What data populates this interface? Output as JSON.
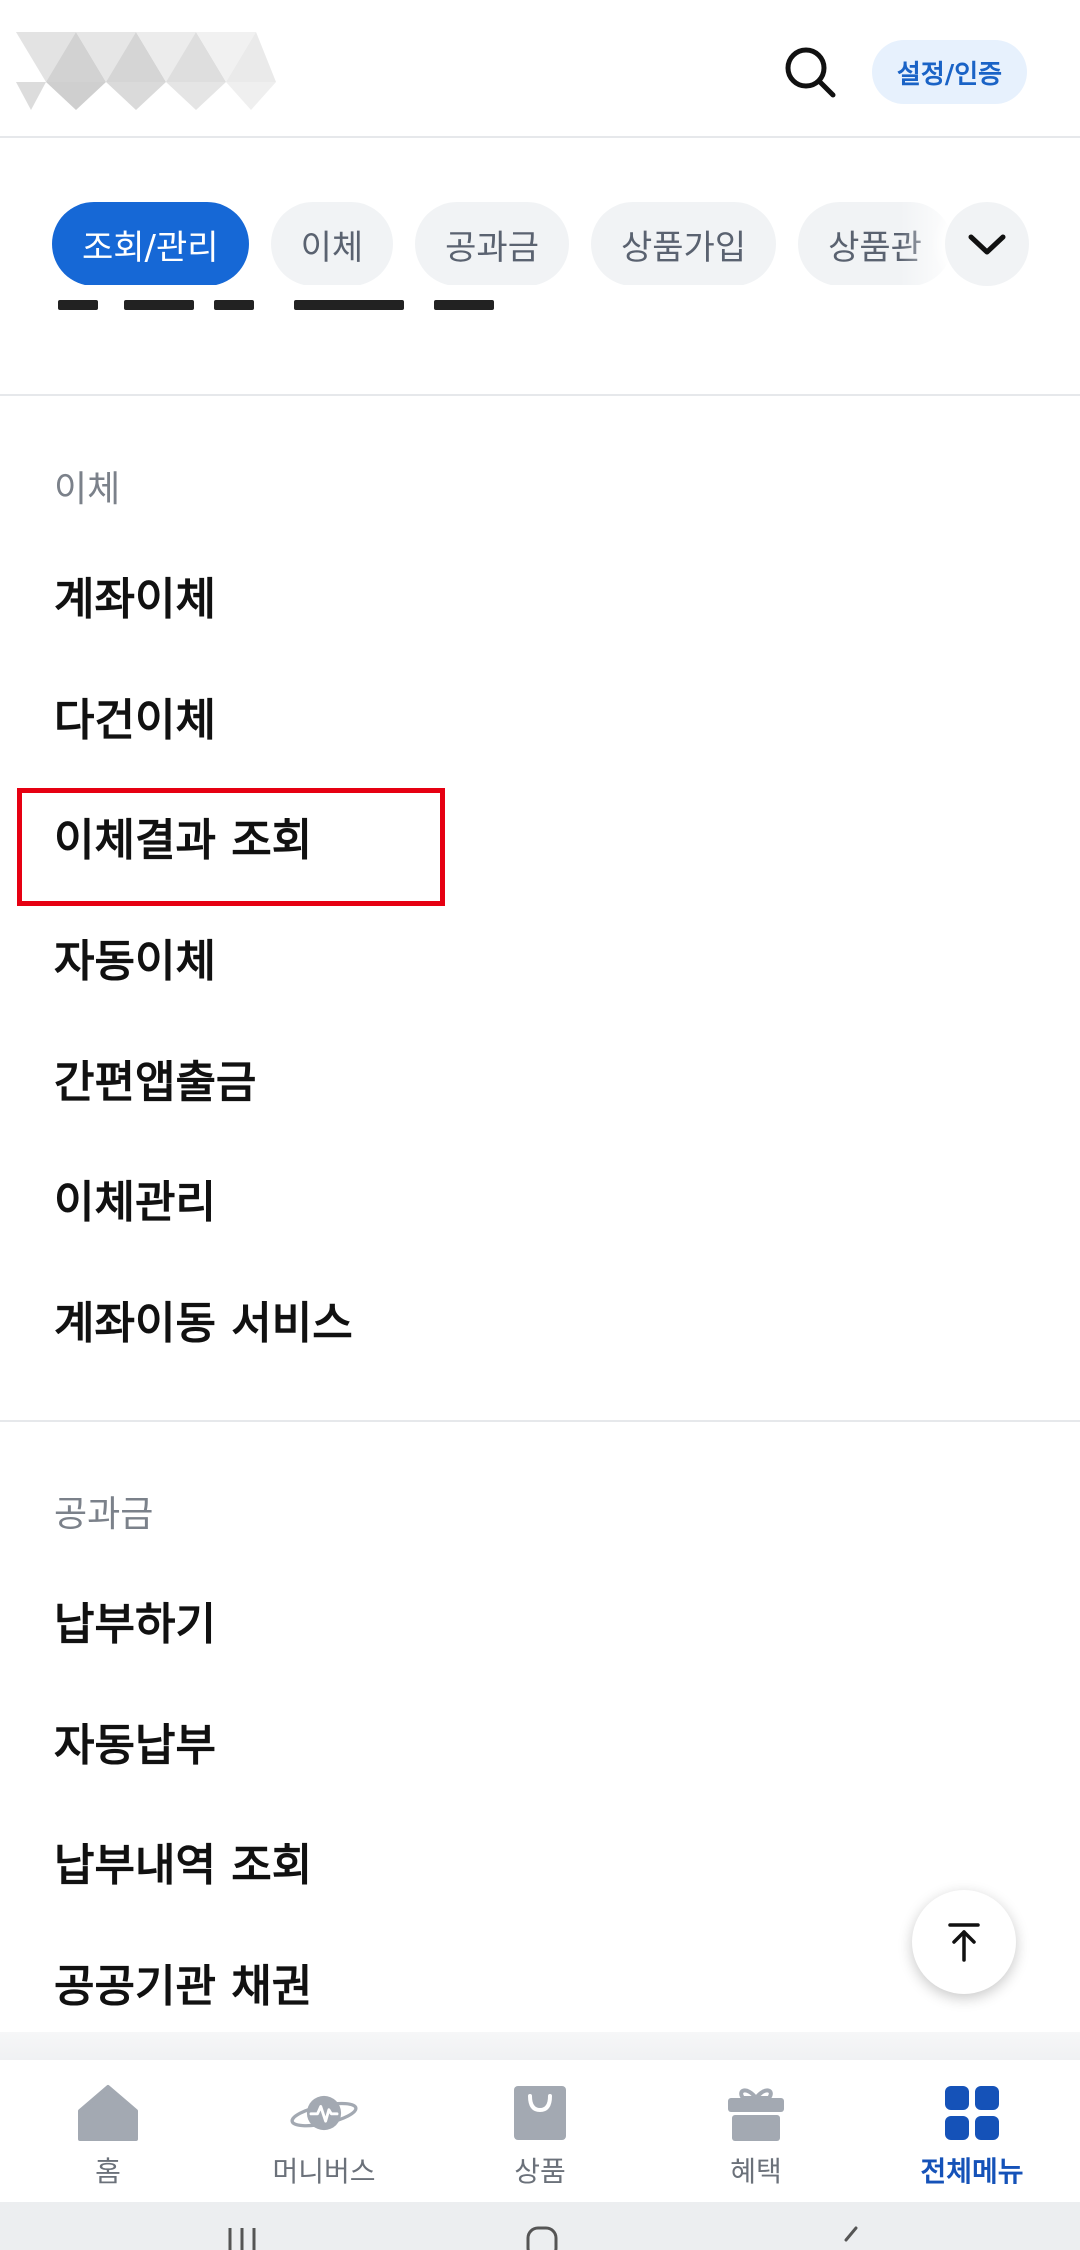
{
  "header": {
    "settings_label": "설정/인증"
  },
  "chips": [
    "조회/관리",
    "이체",
    "공과금",
    "상품가입",
    "상품관"
  ],
  "sections": [
    {
      "title": "이체",
      "items": [
        "계좌이체",
        "다건이체",
        "이체결과 조회",
        "자동이체",
        "간편앱출금",
        "이체관리",
        "계좌이동 서비스"
      ]
    },
    {
      "title": "공과금",
      "items": [
        "납부하기",
        "자동납부",
        "납부내역 조회",
        "공공기관 채권"
      ]
    }
  ],
  "bottom_nav": [
    {
      "label": "홈",
      "icon": "home-icon"
    },
    {
      "label": "머니버스",
      "icon": "planet-icon"
    },
    {
      "label": "상품",
      "icon": "shopping-bag-icon"
    },
    {
      "label": "혜택",
      "icon": "gift-icon"
    },
    {
      "label": "전체메뉴",
      "icon": "grid-menu-icon"
    }
  ],
  "colors": {
    "accent": "#1668d6",
    "active_nav": "#1552b8",
    "highlight": "#e60012",
    "chip_bg": "#f1f3f5"
  }
}
